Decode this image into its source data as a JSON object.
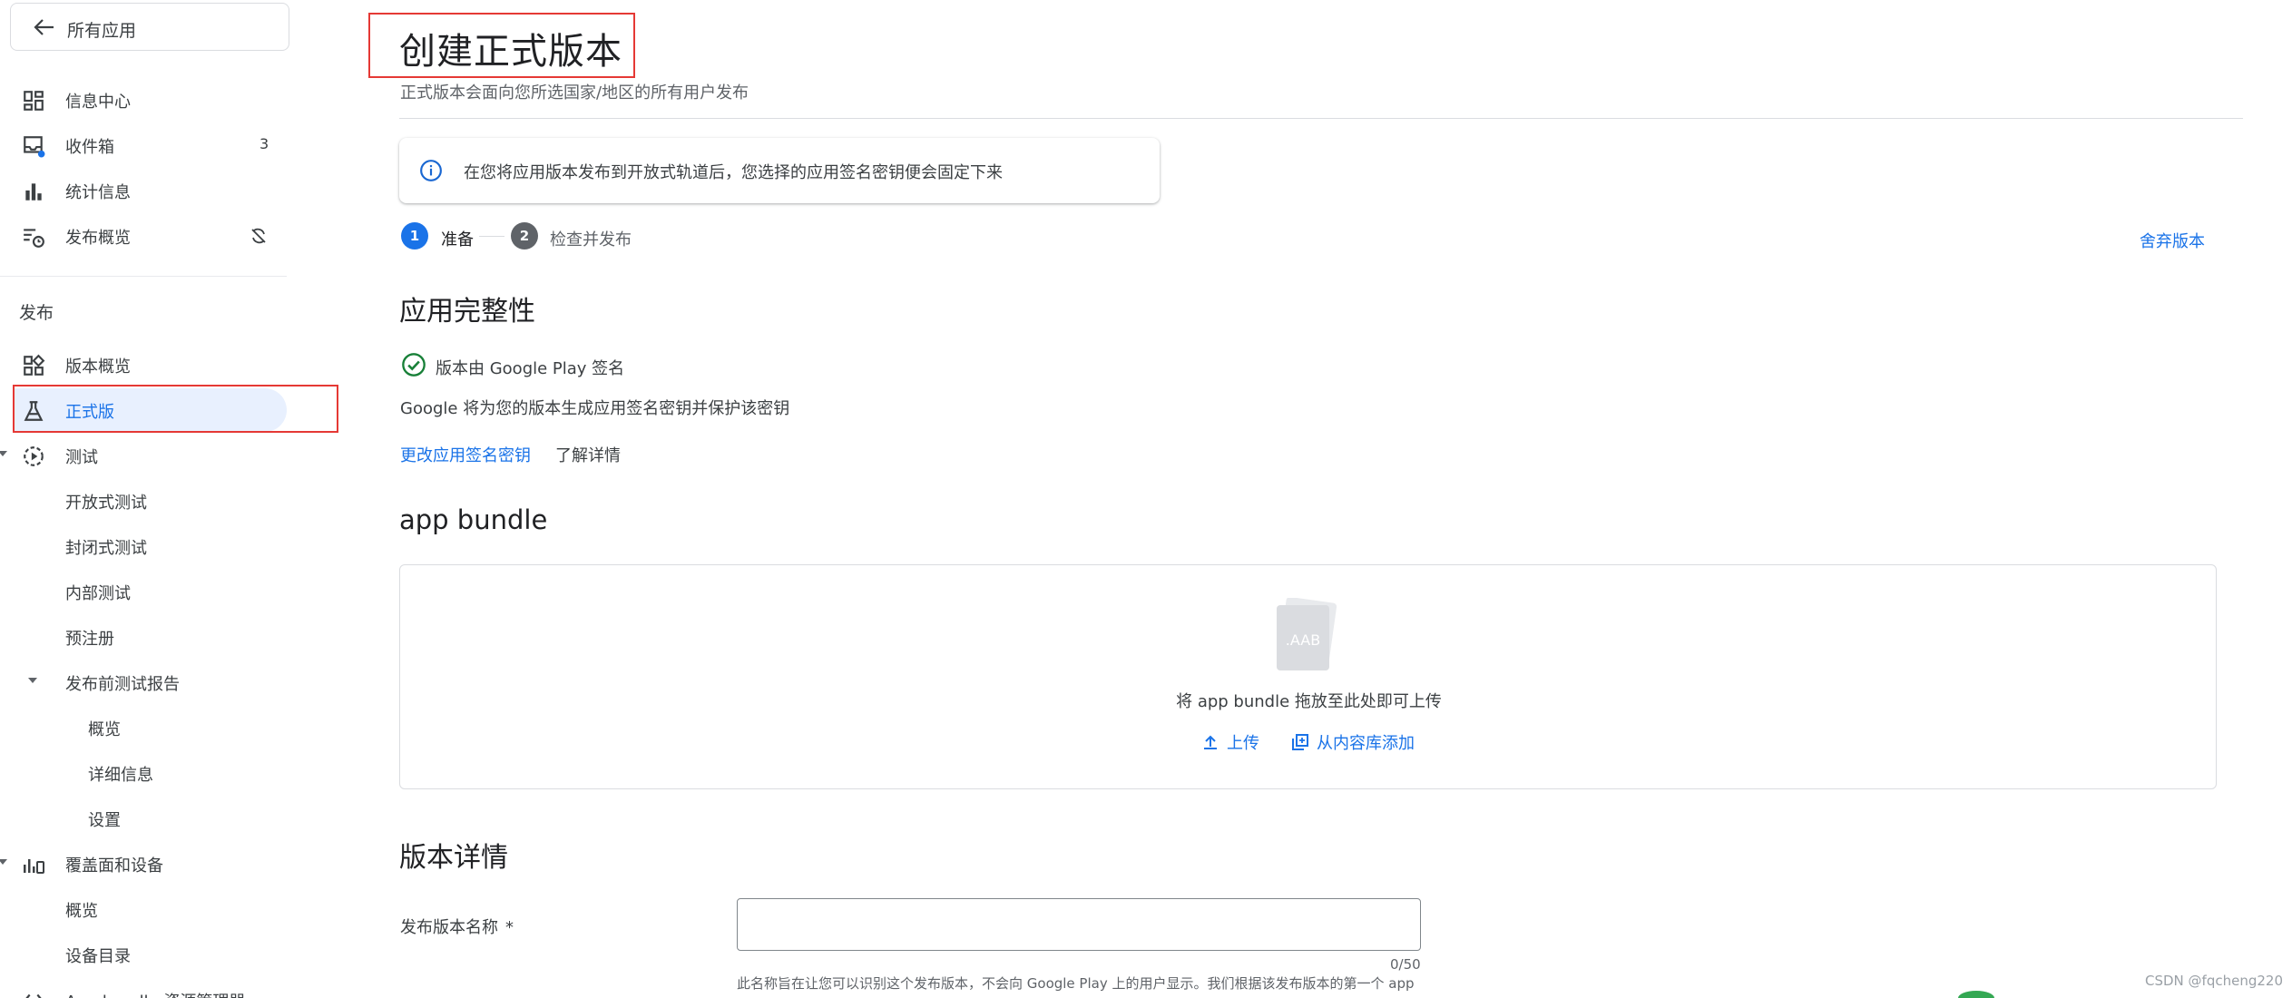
{
  "sidebar": {
    "back_label": "所有应用",
    "items": [
      {
        "label": "信息中心",
        "icon": "dashboard-icon"
      },
      {
        "label": "收件箱",
        "icon": "inbox-icon",
        "count": "3"
      },
      {
        "label": "统计信息",
        "icon": "bar-chart-icon"
      },
      {
        "label": "发布概览",
        "icon": "publish-overview-icon"
      }
    ],
    "section_title": "发布",
    "release_items": [
      {
        "label": "版本概览",
        "icon": "release-overview-icon"
      },
      {
        "label": "正式版",
        "icon": "production-icon"
      },
      {
        "label": "测试",
        "icon": "testing-icon"
      },
      {
        "label": "开放式测试"
      },
      {
        "label": "封闭式测试"
      },
      {
        "label": "内部测试"
      },
      {
        "label": "预注册"
      },
      {
        "label": "发布前测试报告"
      },
      {
        "label": "概览"
      },
      {
        "label": "详细信息"
      },
      {
        "label": "设置"
      },
      {
        "label": "覆盖面和设备",
        "icon": "reach-devices-icon"
      },
      {
        "label": "概览"
      },
      {
        "label": "设备目录"
      },
      {
        "label": "App bundle 资源管理器"
      }
    ]
  },
  "main": {
    "title": "创建正式版本",
    "subtitle": "正式版本会面向您所选国家/地区的所有用户发布",
    "info_text": "在您将应用版本发布到开放式轨道后，您选择的应用签名密钥便会固定下来",
    "steps": [
      {
        "number": "1",
        "label": "准备"
      },
      {
        "number": "2",
        "label": "检查并发布"
      }
    ],
    "discard_label": "舍弃版本",
    "integrity": {
      "heading": "应用完整性",
      "signed_label": "版本由 Google Play 签名",
      "description": "Google 将为您的版本生成应用签名密钥并保护该密钥",
      "change_key_link": "更改应用签名密钥",
      "learn_more": "了解详情"
    },
    "bundle": {
      "heading": "app bundle",
      "aab_label": ".AAB",
      "drop_text": "将 app bundle 拖放至此处即可上传",
      "upload_label": "上传",
      "library_label": "从内容库添加"
    },
    "details": {
      "heading": "版本详情",
      "name_label": "发布版本名称",
      "required_mark": "*",
      "name_value": "",
      "counter": "0/50",
      "helper": "此名称旨在让您可以识别这个发布版本，不会向 Google Play 上的用户显示。我们根据该发布版本的第一个 app"
    }
  },
  "watermark": "CSDN @fqcheng220",
  "colors": {
    "accent": "#1a73e8",
    "active_bg": "#e8f0fe",
    "success": "#188038",
    "highlight_box": "#e53935"
  }
}
